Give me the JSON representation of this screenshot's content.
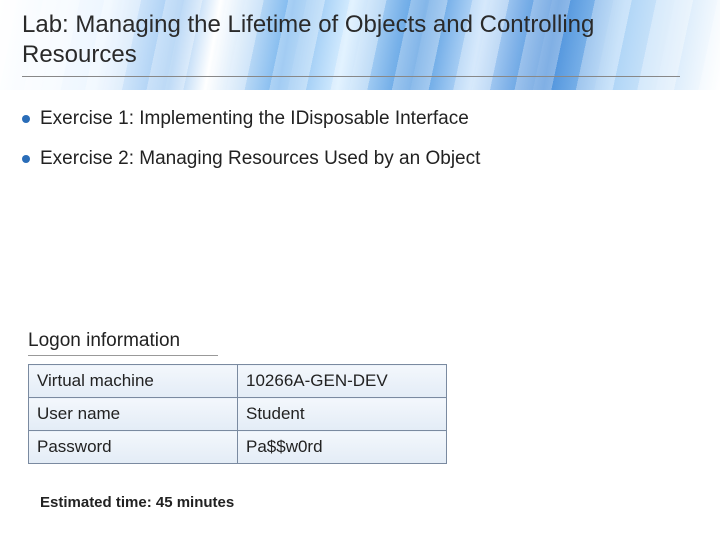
{
  "title": "Lab: Managing the Lifetime of Objects and Controlling Resources",
  "exercises": [
    "Exercise 1: Implementing the IDisposable Interface",
    "Exercise 2: Managing Resources Used by an Object"
  ],
  "logon": {
    "heading": "Logon information",
    "rows": [
      {
        "label": "Virtual machine",
        "value": "10266A-GEN-DEV"
      },
      {
        "label": "User name",
        "value": "Student"
      },
      {
        "label": "Password",
        "value": "Pa$$w0rd"
      }
    ]
  },
  "estimated_time": "Estimated time: 45 minutes"
}
